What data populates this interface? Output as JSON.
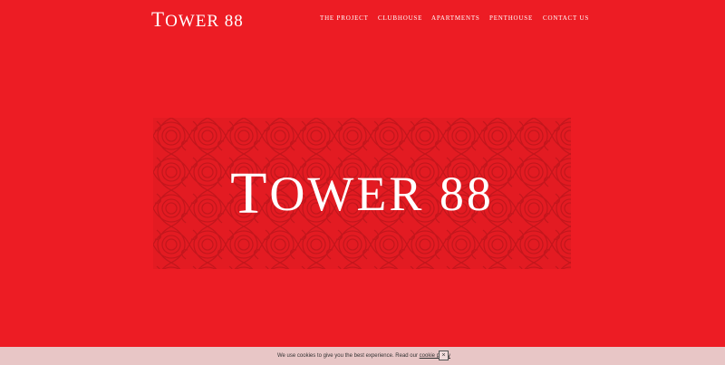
{
  "header": {
    "logo_first": "T",
    "logo_rest": "OWER 88"
  },
  "nav": {
    "items": [
      {
        "label": "The Project"
      },
      {
        "label": "Clubhouse"
      },
      {
        "label": "Apartments"
      },
      {
        "label": "Penthouse"
      },
      {
        "label": "Contact Us"
      }
    ]
  },
  "hero": {
    "title_first": "T",
    "title_rest": "OWER 88"
  },
  "cookie_bar": {
    "text": "We use cookies to give you the best experience. Read our ",
    "link_label": "cookie policy",
    "close_label": "×"
  },
  "colors": {
    "background": "#ed1c24",
    "pattern_stroke": "#c4161c",
    "cookie_bar": "#e8c6c6"
  }
}
